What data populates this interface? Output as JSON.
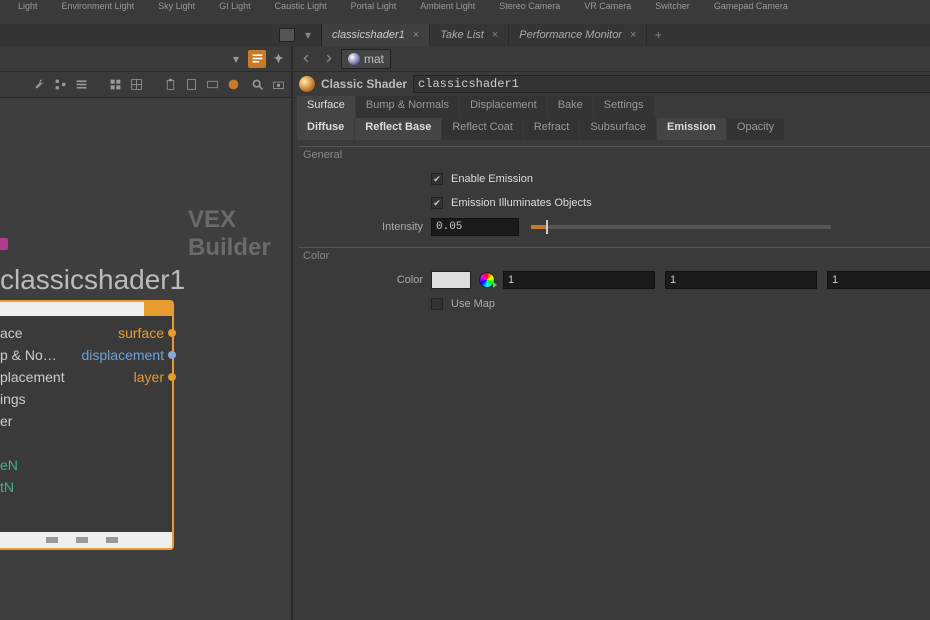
{
  "shelf": [
    {
      "label": "Light"
    },
    {
      "label": "Environment Light"
    },
    {
      "label": "Sky Light"
    },
    {
      "label": "GI Light"
    },
    {
      "label": "Caustic Light"
    },
    {
      "label": "Portal Light"
    },
    {
      "label": "Ambient Light"
    },
    {
      "label": "Stereo Camera"
    },
    {
      "label": "VR Camera"
    },
    {
      "label": "Switcher"
    },
    {
      "label": "Gamepad Camera"
    }
  ],
  "window_tabs": [
    {
      "name": "classicshader1",
      "active": true
    },
    {
      "name": "Take List",
      "active": false
    },
    {
      "name": "Performance Monitor",
      "active": false
    }
  ],
  "path_bar": {
    "path": "mat"
  },
  "vex_title": "VEX Builder",
  "node": {
    "title": "classicshader1",
    "rows": [
      {
        "l": "ace",
        "r": "surface",
        "port": "orange"
      },
      {
        "l": "p & No…",
        "r": "displacement",
        "port": "blue"
      },
      {
        "l": "placement",
        "r": "layer",
        "port": "orange"
      },
      {
        "l": "ings",
        "r": ""
      },
      {
        "l": "er",
        "r": ""
      },
      {
        "l": "",
        "r": ""
      },
      {
        "l": "eN",
        "r": "",
        "teal": true
      },
      {
        "l": "tN",
        "r": "",
        "teal": true
      }
    ]
  },
  "header": {
    "type_label": "Classic Shader",
    "name": "classicshader1"
  },
  "tabs_primary": [
    "Surface",
    "Bump & Normals",
    "Displacement",
    "Bake",
    "Settings"
  ],
  "tabs_primary_active": 0,
  "tabs_sub": [
    "Diffuse",
    "Reflect Base",
    "Reflect Coat",
    "Refract",
    "Subsurface",
    "Emission",
    "Opacity"
  ],
  "tabs_sub_active": 5,
  "general": {
    "legend": "General",
    "enable_emission": {
      "label": "Enable Emission",
      "checked": true
    },
    "illuminates": {
      "label": "Emission Illuminates Objects",
      "checked": true
    },
    "intensity": {
      "label": "Intensity",
      "value": "0.05"
    }
  },
  "color": {
    "legend": "Color",
    "label": "Color",
    "r": "1",
    "g": "1",
    "b": "1",
    "use_map": {
      "label": "Use Map",
      "checked": false
    }
  }
}
